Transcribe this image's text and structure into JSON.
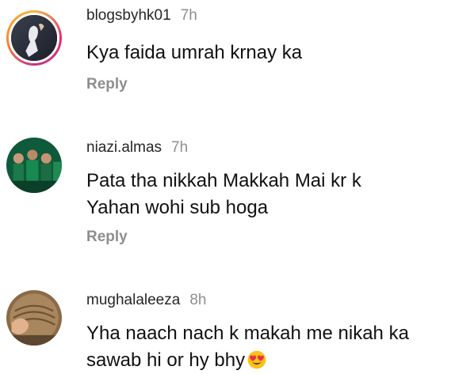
{
  "comments": [
    {
      "username": "blogsbyhk01",
      "time": "7h",
      "text": "Kya faida umrah krnay ka",
      "reply_label": "Reply",
      "has_story_ring": true
    },
    {
      "username": "niazi.almas",
      "time": "7h",
      "text_line1": "Pata tha nikkah Makkah Mai kr k",
      "text_line2": "Yahan wohi sub hoga",
      "reply_label": "Reply",
      "has_story_ring": false
    },
    {
      "username": "mughalaleeza",
      "time": "8h",
      "text_line1": "Yha naach nach k makah me nikah ka",
      "text_line2": "sawab hi or hy bhy",
      "emoji": "heart-eyes-emoji",
      "has_story_ring": false
    }
  ],
  "colors": {
    "username": "#262626",
    "time": "#8e8e8e",
    "reply": "#8e8e8e",
    "text": "#111111"
  }
}
